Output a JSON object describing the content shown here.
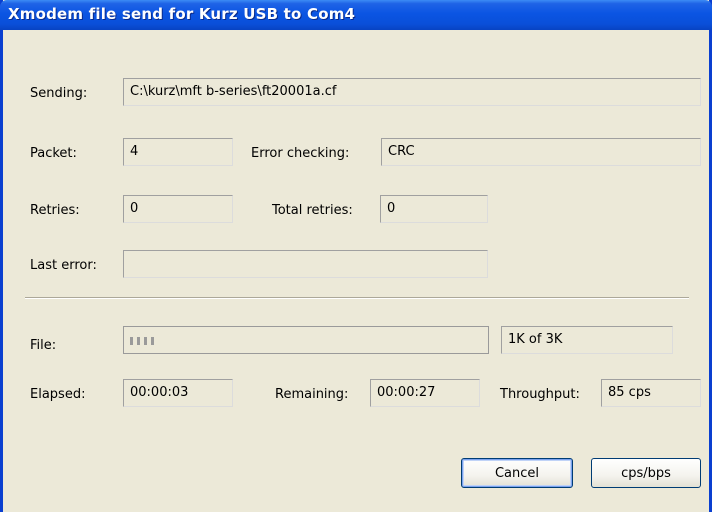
{
  "window": {
    "title": "Xmodem file send for Kurz USB to Com4"
  },
  "fields": {
    "sending_label": "Sending:",
    "sending_value": "C:\\kurz\\mft b-series\\ft20001a.cf",
    "packet_label": "Packet:",
    "packet_value": "4",
    "error_checking_label": "Error checking:",
    "error_checking_value": "CRC",
    "retries_label": "Retries:",
    "retries_value": "0",
    "total_retries_label": "Total retries:",
    "total_retries_value": "0",
    "last_error_label": "Last error:",
    "last_error_value": ""
  },
  "transfer": {
    "file_label": "File:",
    "progress_fraction": 0.08,
    "file_amount": "1K of 3K",
    "elapsed_label": "Elapsed:",
    "elapsed_value": "00:00:03",
    "remaining_label": "Remaining:",
    "remaining_value": "00:00:27",
    "throughput_label": "Throughput:",
    "throughput_value": "85 cps"
  },
  "buttons": {
    "cancel": "Cancel",
    "cps_bps": "cps/bps"
  },
  "colors": {
    "titlebar": "#0b55e3",
    "window_bg": "#ece9d8"
  }
}
